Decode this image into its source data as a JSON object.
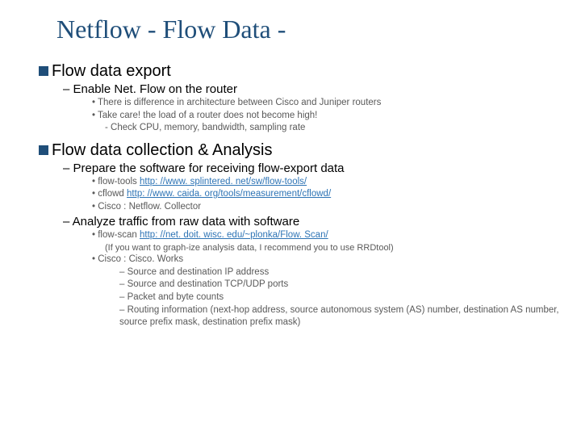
{
  "title": "Netflow - Flow Data -",
  "s1": {
    "head": "Flow data export",
    "sub1": "– Enable Net. Flow on the router",
    "b1": "There is difference in architecture between Cisco and Juniper routers",
    "b2": "Take care!  the load of a router does not become high!",
    "b3": "Check CPU, memory, bandwidth, sampling rate"
  },
  "s2": {
    "head": "Flow data collection & Analysis",
    "sub1": "– Prepare the software for receiving flow-export data",
    "a1p": "flow-tools ",
    "a1l": "http: //www. splintered. net/sw/flow-tools/",
    "a2p": "cflowd  ",
    "a2l": "http: //www. caida. org/tools/measurement/cflowd/",
    "a3": "Cisco : Netflow. Collector",
    "sub2": "– Analyze traffic from raw data with software",
    "c1p": "flow-scan ",
    "c1l": "http: //net. doit. wisc. edu/~plonka/Flow. Scan/",
    "note": "(If you want to graph-ize analysis data, I recommend you to use RRDtool)",
    "c2": "Cisco : Cisco. Works",
    "d1": "Source and destination IP address",
    "d2": "Source and destination TCP/UDP ports",
    "d3": "Packet and byte counts",
    "d4": "Routing information (next-hop address, source autonomous system (AS) number, destination AS number, source prefix mask, destination prefix mask)"
  }
}
